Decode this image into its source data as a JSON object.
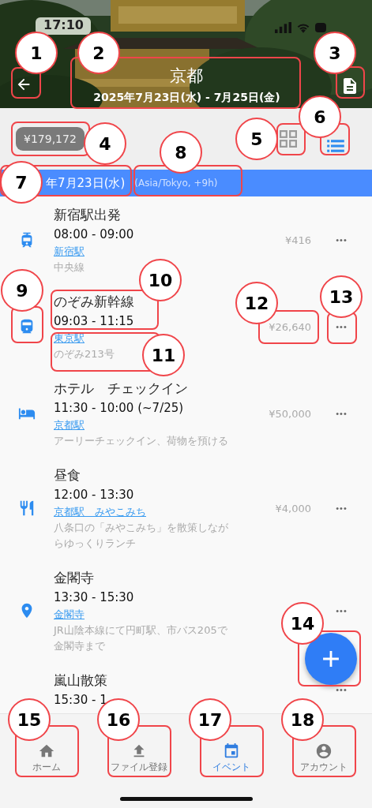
{
  "status_bar": {
    "time": "17:10"
  },
  "header": {
    "title": "京都",
    "dates": "2025年7月23日(水) - 7月25日(金)"
  },
  "toolbar": {
    "total": "¥179,172",
    "views": [
      {
        "kind": "grid",
        "selected": false
      },
      {
        "kind": "list",
        "selected": true
      }
    ]
  },
  "day_header": {
    "date": "年7月23日(水)",
    "timezone": "(Asia/Tokyo, +9h)"
  },
  "events": [
    {
      "kind": "tram",
      "title": "新宿駅出発",
      "time": "08:00 - 09:00",
      "link": "新宿駅",
      "note": "中央線",
      "price": "¥416",
      "more": "•••"
    },
    {
      "kind": "train",
      "title": "のぞみ新幹線",
      "time": "09:03 - 11:15",
      "link": "東京駅",
      "note": "のぞみ213号",
      "price": "¥26,640",
      "more": "•••"
    },
    {
      "kind": "hotel",
      "title": "ホテル　チェックイン",
      "time": "11:30 - 10:00 (~7/25)",
      "link": "京都駅",
      "note": "アーリーチェックイン、荷物を預ける",
      "price": "¥50,000",
      "more": "•••"
    },
    {
      "kind": "restaurant",
      "title": "昼食",
      "time": "12:00 - 13:30",
      "link": "京都駅　みやこみち",
      "note": "八条口の「みやこみち」を散策しながらゆっくりランチ",
      "price": "¥4,000",
      "more": "•••"
    },
    {
      "kind": "place",
      "title": "金閣寺",
      "time": "13:30 - 15:30",
      "link": "金閣寺",
      "note": "JR山陰本線にて円町駅、市バス205で金閣寺まで",
      "more": "•••"
    },
    {
      "title": "嵐山散策",
      "time": "15:30 - 1",
      "more": "•••"
    }
  ],
  "bottom_nav": [
    {
      "kind": "home",
      "label": "ホーム",
      "selected": false
    },
    {
      "kind": "upload",
      "label": "ファイル登録",
      "selected": false
    },
    {
      "kind": "calendar",
      "label": "イベント",
      "selected": true
    },
    {
      "kind": "account",
      "label": "アカウント",
      "selected": false
    }
  ],
  "annotations": [
    {
      "number": "1"
    },
    {
      "number": "2"
    },
    {
      "number": "3"
    },
    {
      "number": "4"
    },
    {
      "number": "5"
    },
    {
      "number": "6"
    },
    {
      "number": "7"
    },
    {
      "number": "8"
    },
    {
      "number": "9"
    },
    {
      "number": "10"
    },
    {
      "number": "11"
    },
    {
      "number": "12"
    },
    {
      "number": "13"
    },
    {
      "number": "14"
    },
    {
      "number": "15"
    },
    {
      "number": "16"
    },
    {
      "number": "17"
    },
    {
      "number": "18"
    }
  ]
}
